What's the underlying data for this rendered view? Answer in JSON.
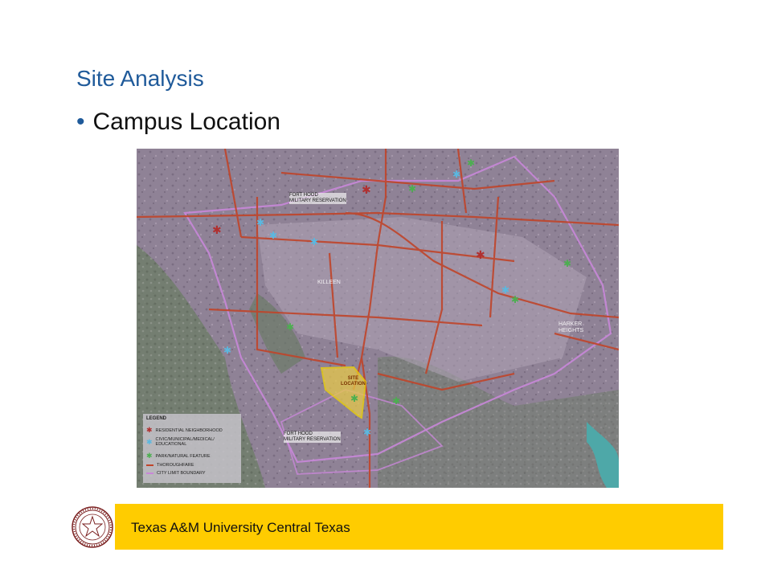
{
  "slide": {
    "title": "Site Analysis",
    "bullet": "Campus Location"
  },
  "map": {
    "labels": {
      "fort_hood_north": "FORT HOOD\nMILITARY RESERVATION",
      "killeen": "KILLEEN",
      "harker_heights": "HARKER\nHEIGHTS",
      "site_location": "SITE\nLOCATION",
      "fort_hood_south": "FORT HOOD\nMILITARY RESERVATION"
    },
    "legend": {
      "title": "LEGEND",
      "items": [
        {
          "icon": "residential-icon",
          "label": "RESIDENTIAL NEIGHBORHOOD",
          "color": "#b03030"
        },
        {
          "icon": "civic-icon",
          "label": "CIVIC/MUNICIPAL/MEDICAL/ EDUCATIONAL",
          "color": "#5ab8e0"
        },
        {
          "icon": "park-icon",
          "label": "PARK/NATURAL FEATURE",
          "color": "#4caf50"
        },
        {
          "icon": "thoroughfare-line",
          "label": "THOROUGHFARE",
          "color": "#c0452a"
        },
        {
          "icon": "city-limit-line",
          "label": "CITY LIMIT BOUNDARY",
          "color": "#c887d8"
        }
      ]
    }
  },
  "footer": {
    "text": "Texas A&M University Central Texas",
    "color": "#ffcc00"
  }
}
